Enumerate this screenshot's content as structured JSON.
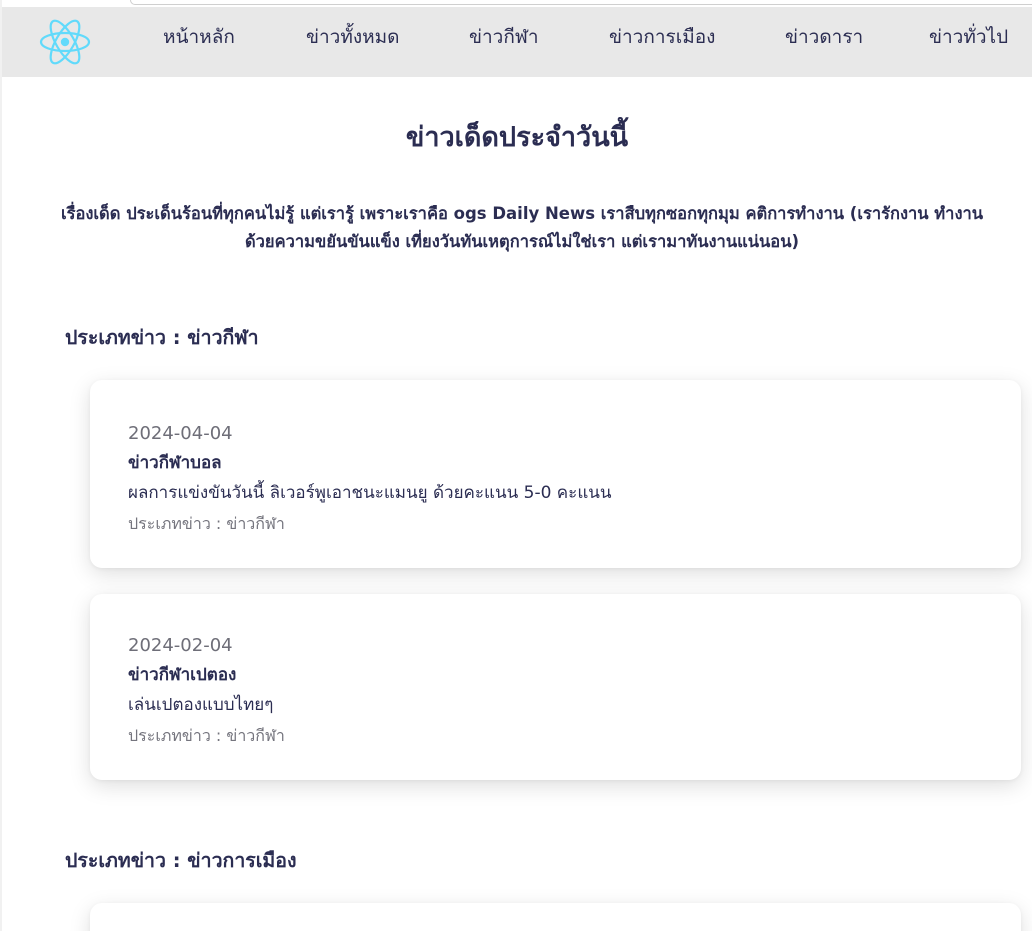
{
  "colors": {
    "navbar_bg": "#e8e8e8",
    "text_primary": "#2b2d52",
    "text_muted": "#6e6e78",
    "logo_accent": "#61dafb"
  },
  "navbar": {
    "logo_icon": "react-atom-icon",
    "items": [
      {
        "label": "หน้าหลัก"
      },
      {
        "label": "ข่าวทั้งหมด"
      },
      {
        "label": "ข่าวกีฬา"
      },
      {
        "label": "ข่าวการเมือง"
      },
      {
        "label": "ข่าวดารา"
      },
      {
        "label": "ข่าวทั่วไป"
      }
    ]
  },
  "main": {
    "title": "ข่าวเด็ดประจำวันนี้",
    "intro_line1": "เรื่องเด็ด ประเด็นร้อนที่ทุกคนไม่รู้ แต่เรารู้ เพราะเราคือ ogs Daily News เราสืบทุกซอกทุกมุม คติการทำงาน (เรารักงาน ทำงาน",
    "intro_line2": "ด้วยความขยันขันแข็ง เที่ยงวันทันเหตุการณ์ไม่ใช่เรา แต่เรามาทันงานแน่นอน)"
  },
  "sections": [
    {
      "heading": "ประเภทข่าว : ข่าวกีฬา",
      "cards": [
        {
          "date": "2024-04-04",
          "title": "ข่าวกีฬาบอล",
          "body": "ผลการแข่งขันวันนี้ ลิเวอร์พูเอาชนะแมนยู ด้วยคะแนน 5-0 คะแนน",
          "category": "ประเภทข่าว : ข่าวกีฬา"
        },
        {
          "date": "2024-02-04",
          "title": "ข่าวกีฬาเปตอง",
          "body": "เล่นเปตองแบบไทยๆ",
          "category": "ประเภทข่าว : ข่าวกีฬา"
        }
      ]
    },
    {
      "heading": "ประเภทข่าว : ข่าวการเมือง",
      "cards": []
    }
  ]
}
